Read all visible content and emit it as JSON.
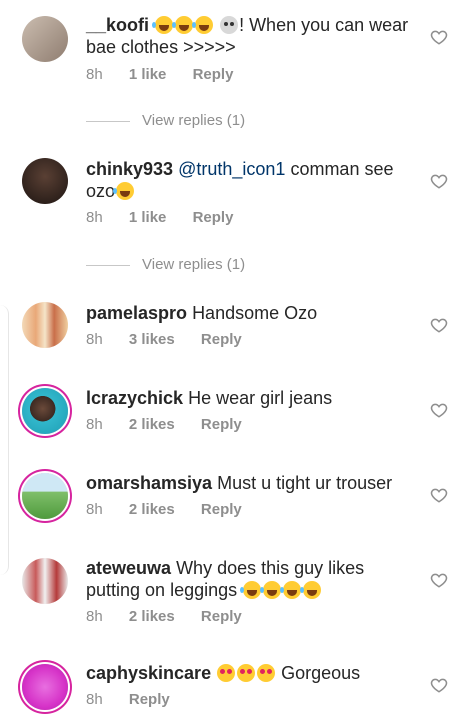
{
  "comments": [
    {
      "username": "__koofi",
      "text": "! When you can wear bae clothes >>>>>",
      "time": "8h",
      "likes": "1 like",
      "reply": "Reply",
      "view_replies": "View replies (1)",
      "avatar_color": "#b9a89a"
    },
    {
      "username": "chinky933",
      "mention": "@truth_icon1",
      "text": "comman see ozo",
      "time": "8h",
      "likes": "1 like",
      "reply": "Reply",
      "view_replies": "View replies (1)",
      "avatar_color": "#3a2a24"
    },
    {
      "username": "pamelaspro",
      "text": "Handsome Ozo",
      "time": "8h",
      "likes": "3 likes",
      "reply": "Reply",
      "avatar_color": "#e7b890"
    },
    {
      "username": "lcrazychick",
      "text": "He wear girl jeans",
      "time": "8h",
      "likes": "2 likes",
      "reply": "Reply",
      "avatar_color": "#2fb3c6"
    },
    {
      "username": "omarshamsiya",
      "text": "Must u tight ur trouser",
      "time": "8h",
      "likes": "2 likes",
      "reply": "Reply",
      "avatar_color": "#7fbf6a"
    },
    {
      "username": "ateweuwa",
      "text": "Why does this guy likes putting on leggings",
      "time": "8h",
      "likes": "2 likes",
      "reply": "Reply",
      "avatar_color": "#c85a5a"
    },
    {
      "username": "caphyskincare",
      "text": "Gorgeous",
      "time": "8h",
      "reply": "Reply",
      "avatar_color": "#d633c8"
    }
  ],
  "colors": {
    "meta": "#8e8e8e",
    "mention": "#003569",
    "story_ring": "#d6249f"
  },
  "icons": {
    "like": "heart-outline-icon"
  }
}
